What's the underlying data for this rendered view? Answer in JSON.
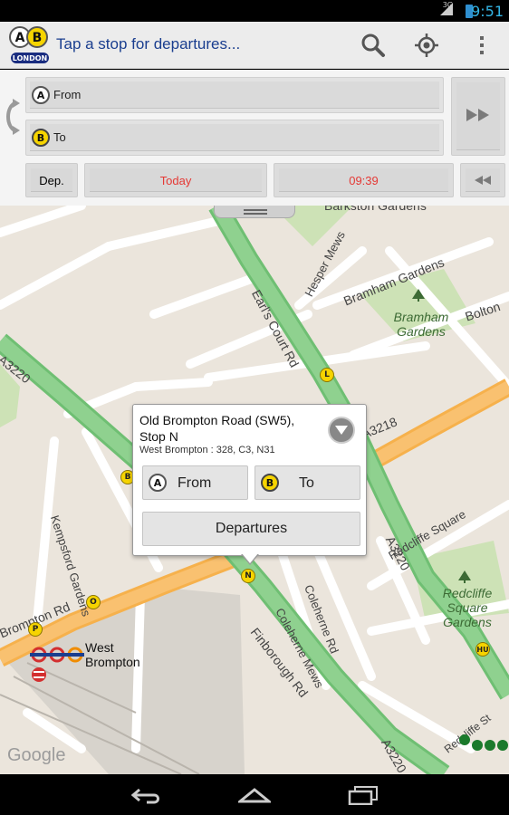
{
  "status_bar": {
    "time": "9:51",
    "network": "3G"
  },
  "action_bar": {
    "title": "Tap a stop for departures...",
    "logo_text": "LONDON",
    "logo_letters": [
      "A",
      "B"
    ],
    "icons": [
      "search-icon",
      "locate-icon",
      "overflow-menu-icon"
    ]
  },
  "journey_form": {
    "from_badge": "A",
    "from_label": "From",
    "to_badge": "B",
    "to_label": "To",
    "dep_label": "Dep.",
    "date_value": "Today",
    "time_value": "09:39",
    "accent_color": "#e53935"
  },
  "map": {
    "roads": [
      "Earl's Court Rd",
      "A3220",
      "A3218",
      "Finborough Rd",
      "Brompton Rd",
      "Kempsford Gardens",
      "Coleherne Mews",
      "Coleherne Rd",
      "Redcliffe Square",
      "Redcliffe St",
      "Bramham Gardens",
      "Hesper Mews",
      "Bolton",
      "Barkston Gardens"
    ],
    "parks": [
      "Bramham Gardens",
      "Redcliffe Square Gardens"
    ],
    "places": [
      "West Brompton"
    ],
    "stop_letters": [
      "L",
      "N",
      "O",
      "P",
      "HU",
      "B"
    ],
    "watermark": "Google"
  },
  "popup": {
    "title": "Old Brompton Road (SW5), Stop N",
    "routes": "West Brompton : 328, C3, N31",
    "from_badge": "A",
    "from_label": "From",
    "to_badge": "B",
    "to_label": "To",
    "departures_label": "Departures"
  }
}
